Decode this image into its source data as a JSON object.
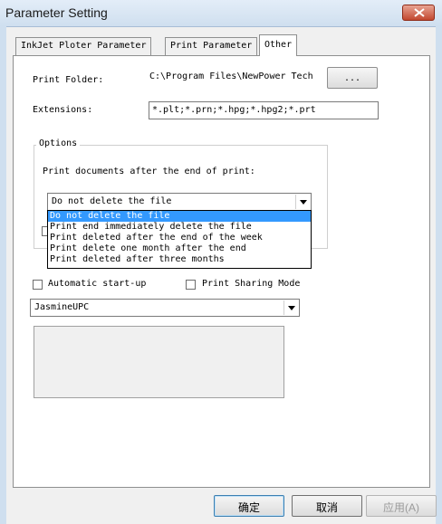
{
  "window": {
    "title": "Parameter Setting"
  },
  "tabs": [
    {
      "label": "InkJet Ploter Parameter"
    },
    {
      "label": "Print Parameter"
    },
    {
      "label": "Other"
    }
  ],
  "print_folder": {
    "label": "Print Folder:",
    "value": "C:\\Program Files\\NewPower Tech",
    "browse_label": "..."
  },
  "extensions": {
    "label": "Extensions:",
    "value": "*.plt;*.prn;*.hpg;*.hpg2;*.prt"
  },
  "options": {
    "legend": "Options",
    "prompt": "Print documents after the end of  print:",
    "selected": "Do not delete the file",
    "items": [
      "Do not delete the file",
      "Print end immediately delete the file",
      "Print deleted after the end of the week",
      "Print delete one month after the end",
      "Print deleted after three months"
    ]
  },
  "checkboxes": {
    "auto_start": "Automatic start-up",
    "sharing_mode": "Print Sharing Mode"
  },
  "font_select": {
    "value": "JasmineUPC"
  },
  "buttons": {
    "ok": "确定",
    "cancel": "取消",
    "apply": "应用(A)"
  },
  "colors": {
    "selection": "#3399ff",
    "close_button": "#c2472f",
    "title_bar": "#dbe7f4"
  }
}
